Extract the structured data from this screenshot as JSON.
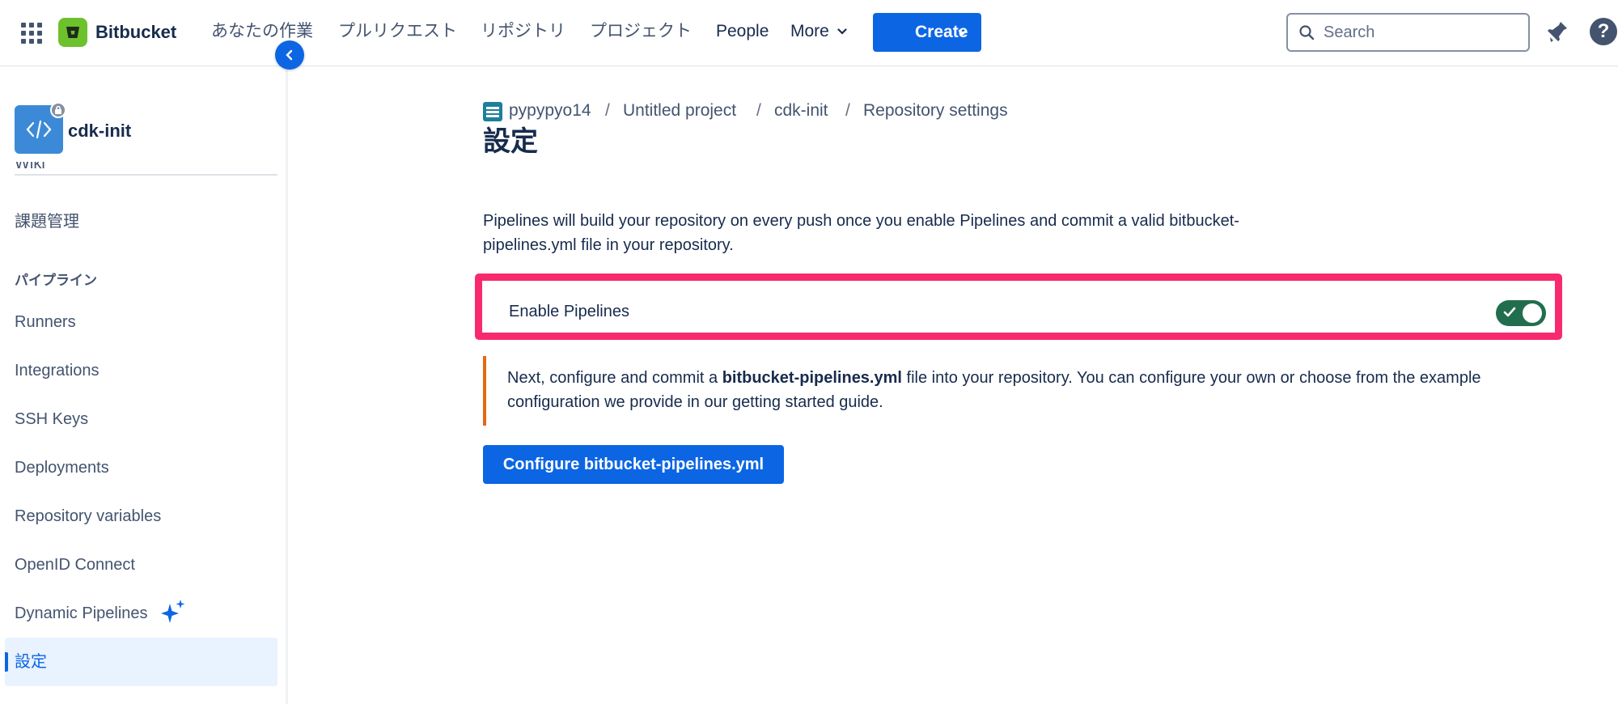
{
  "topbar": {
    "brand": "Bitbucket",
    "nav": [
      "あなたの作業",
      "プルリクエスト",
      "リポジトリ",
      "プロジェクト",
      "People",
      "More"
    ],
    "create_label": "Create",
    "search_placeholder": "Search",
    "help_glyph": "?"
  },
  "sidebar": {
    "repo_name": "cdk-init",
    "partial_item": "Wiki",
    "items": [
      "課題管理",
      "Runners",
      "Integrations",
      "SSH Keys",
      "Deployments",
      "Repository variables",
      "OpenID Connect",
      "Dynamic Pipelines",
      "設定"
    ],
    "section_heading": "パイプライン",
    "active_item": "設定"
  },
  "breadcrumb": {
    "items": [
      "pypypyo14",
      "Untitled project",
      "cdk-init",
      "Repository settings"
    ],
    "separator": "/"
  },
  "main": {
    "title": "設定",
    "description": "Pipelines will build your repository on every push once you enable Pipelines and commit a valid bitbucket-pipelines.yml file in your repository.",
    "toggle_label": "Enable Pipelines",
    "toggle_on": true,
    "notice_prefix": "Next, configure and commit a ",
    "notice_bold": "bitbucket-pipelines.yml",
    "notice_suffix": " file into your repository. You can configure your own or choose from the example configuration we provide in our getting started guide.",
    "configure_button": "Configure bitbucket-pipelines.yml"
  },
  "colors": {
    "primary": "#0c66e4",
    "highlight_border": "#f72a6e",
    "notice_accent": "#e56910",
    "toggle_on": "#216e4e",
    "logo": "#6dc12d"
  },
  "icons": [
    "app-switcher-icon",
    "bitbucket-logo-icon",
    "chevron-down-icon",
    "search-icon",
    "bell-icon",
    "help-icon",
    "code-icon",
    "lock-icon",
    "chevron-left-icon",
    "project-icon",
    "sparkle-icon",
    "check-icon"
  ]
}
